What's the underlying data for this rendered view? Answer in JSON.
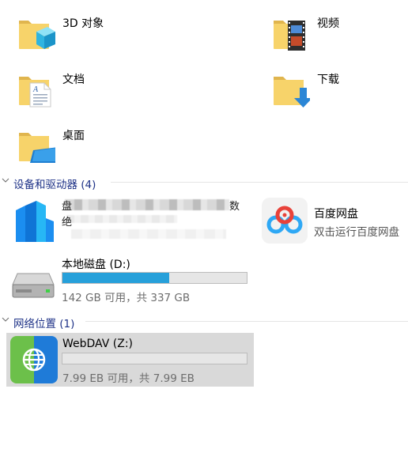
{
  "folders": [
    {
      "label": "3D 对象",
      "icon": "3d-objects-folder-icon"
    },
    {
      "label": "视频",
      "icon": "videos-folder-icon"
    },
    {
      "label": "文档",
      "icon": "documents-folder-icon"
    },
    {
      "label": "下载",
      "icon": "downloads-folder-icon"
    },
    {
      "label": "桌面",
      "icon": "desktop-folder-icon"
    }
  ],
  "devices_section": {
    "title": "设备和驱动器 (4)"
  },
  "devices": {
    "redacted_app": {
      "icon": "blue-app-icon",
      "visible_chars": [
        "盘",
        "数",
        "绝"
      ]
    },
    "baidu": {
      "name": "百度网盘",
      "subtitle": "双击运行百度网盘",
      "icon": "baidu-netdisk-icon"
    },
    "local_disk": {
      "name": "本地磁盘 (D:)",
      "space": "142 GB 可用，共 337 GB",
      "used_fraction": 0.58,
      "icon": "hard-drive-icon",
      "bar_color": "#26a0da"
    }
  },
  "network_section": {
    "title": "网络位置 (1)"
  },
  "network": {
    "webdav": {
      "name": "WebDAV (Z:)",
      "space": "7.99 EB 可用，共 7.99 EB",
      "used_fraction": 0.0,
      "icon": "globe-network-drive-icon",
      "selected": true
    }
  },
  "colors": {
    "section_title": "#1e3287",
    "selection_bg": "#d9d9d9",
    "usage_bar": "#26a0da"
  }
}
